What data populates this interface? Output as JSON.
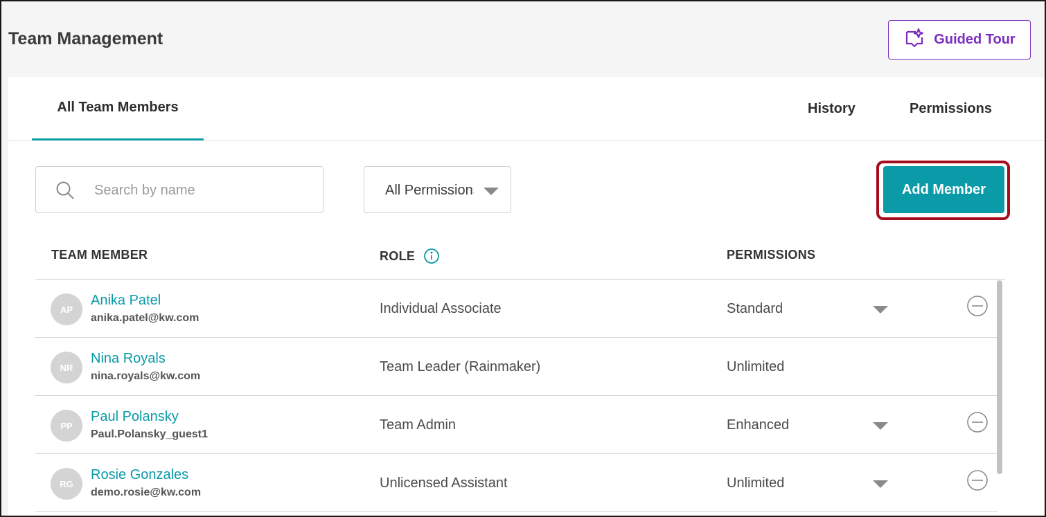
{
  "header": {
    "title": "Team Management",
    "guided_tour_label": "Guided Tour"
  },
  "tabs": [
    {
      "label": "All Team Members",
      "active": true
    },
    {
      "label": "History",
      "active": false
    },
    {
      "label": "Permissions",
      "active": false
    }
  ],
  "toolbar": {
    "search_placeholder": "Search by name",
    "search_value": "",
    "permission_filter_value": "All Permissions",
    "add_member_label": "Add Member"
  },
  "table": {
    "headers": {
      "member": "TEAM MEMBER",
      "role": "ROLE",
      "permissions": "PERMISSIONS"
    },
    "rows": [
      {
        "initials": "AP",
        "name": "Anika Patel",
        "email": "anika.patel@kw.com",
        "role": "Individual Associate",
        "permission": "Standard",
        "editable": true
      },
      {
        "initials": "NR",
        "name": "Nina Royals",
        "email": "nina.royals@kw.com",
        "role": "Team Leader (Rainmaker)",
        "permission": "Unlimited",
        "editable": false
      },
      {
        "initials": "PP",
        "name": "Paul Polansky",
        "email": "Paul.Polansky_guest1",
        "role": "Team Admin",
        "permission": "Enhanced",
        "editable": true
      },
      {
        "initials": "RG",
        "name": "Rosie Gonzales",
        "email": "demo.rosie@kw.com",
        "role": "Unlicensed Assistant",
        "permission": "Unlimited",
        "editable": true
      }
    ]
  },
  "colors": {
    "accent": "#0a9aa8",
    "tour_purple": "#7b2cbf",
    "highlight_red": "#a50d1c"
  },
  "icons": [
    "sparkle-chat-icon",
    "search-icon",
    "chevron-down-icon",
    "info-icon",
    "remove-circle-icon"
  ]
}
